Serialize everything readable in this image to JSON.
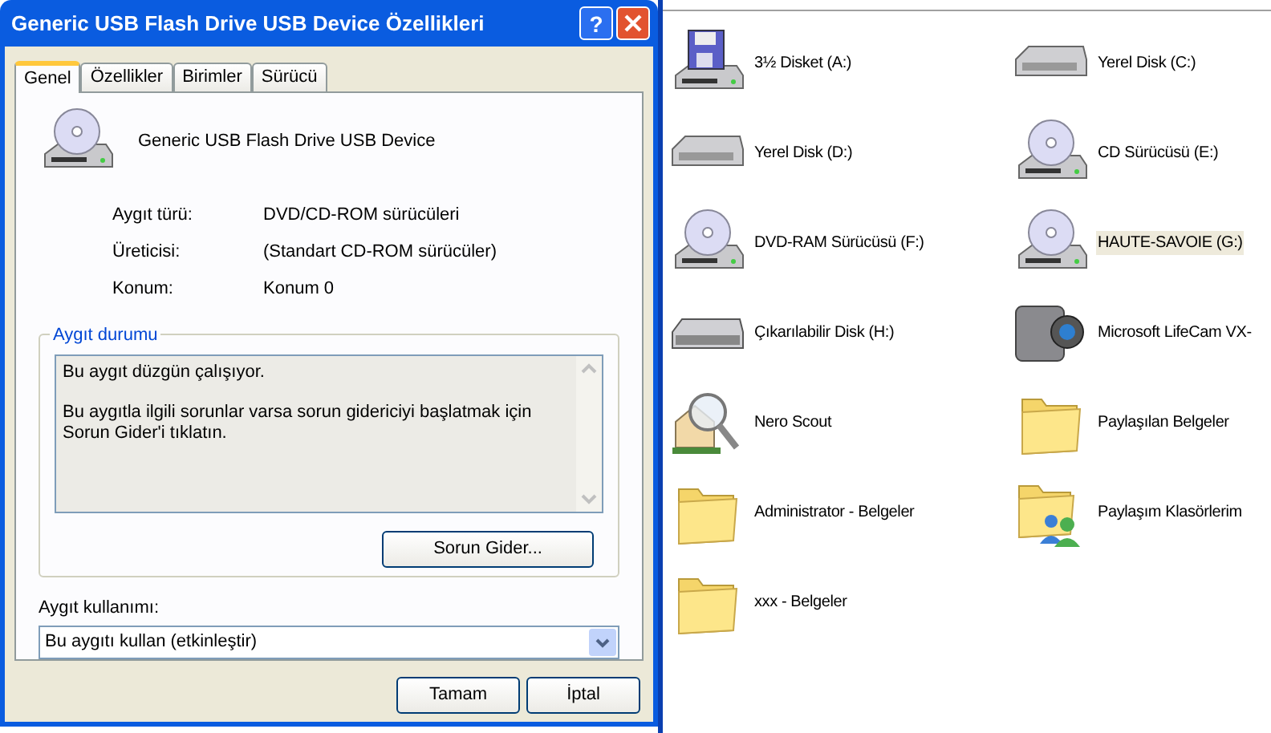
{
  "dialog": {
    "title": "Generic USB Flash Drive USB Device Özellikleri",
    "help_button": "?",
    "tabs": [
      {
        "label": "Genel",
        "selected": true
      },
      {
        "label": "Özellikler",
        "selected": false
      },
      {
        "label": "Birimler",
        "selected": false
      },
      {
        "label": "Sürücü",
        "selected": false
      }
    ],
    "device_name": "Generic USB Flash Drive USB Device",
    "properties": [
      {
        "label": "Aygıt türü:",
        "value": "DVD/CD-ROM sürücüleri"
      },
      {
        "label": "Üreticisi:",
        "value": "(Standart CD-ROM sürücüler)"
      },
      {
        "label": "Konum:",
        "value": "Konum 0"
      }
    ],
    "status_group": {
      "title": "Aygıt durumu",
      "paragraphs": [
        "Bu aygıt düzgün çalışıyor.",
        "Bu aygıtla ilgili sorunlar varsa sorun gidericiyi başlatmak için Sorun Gider'i tıklatın."
      ],
      "button": "Sorun Gider..."
    },
    "usage": {
      "label": "Aygıt kullanımı:",
      "value": "Bu aygıtı kullan (etkinleştir)"
    },
    "buttons": [
      "Tamam",
      "İptal"
    ]
  },
  "explorer": {
    "items": [
      {
        "label": "3½ Disket (A:)",
        "kind": "floppy",
        "selected": false
      },
      {
        "label": "Yerel Disk (C:)",
        "kind": "disk",
        "selected": false
      },
      {
        "label": "Yerel Disk (D:)",
        "kind": "disk",
        "selected": false
      },
      {
        "label": "CD Sürücüsü (E:)",
        "kind": "cd",
        "selected": false
      },
      {
        "label": "DVD-RAM Sürücüsü (F:)",
        "kind": "cd",
        "selected": false
      },
      {
        "label": "HAUTE-SAVOIE (G:)",
        "kind": "cd",
        "selected": true
      },
      {
        "label": "Çıkarılabilir Disk (H:)",
        "kind": "removable",
        "selected": false
      },
      {
        "label": "Microsoft LifeCam VX-",
        "kind": "camera",
        "selected": false
      },
      {
        "label": "Nero Scout",
        "kind": "scout",
        "selected": false
      },
      {
        "label": "Paylaşılan Belgeler",
        "kind": "folder",
        "selected": false
      },
      {
        "label": "Administrator - Belgeler",
        "kind": "folder",
        "selected": false
      },
      {
        "label": "Paylaşım Klasörlerim",
        "kind": "shared",
        "selected": false
      },
      {
        "label": "xxx - Belgeler",
        "kind": "folder",
        "selected": false
      }
    ]
  }
}
